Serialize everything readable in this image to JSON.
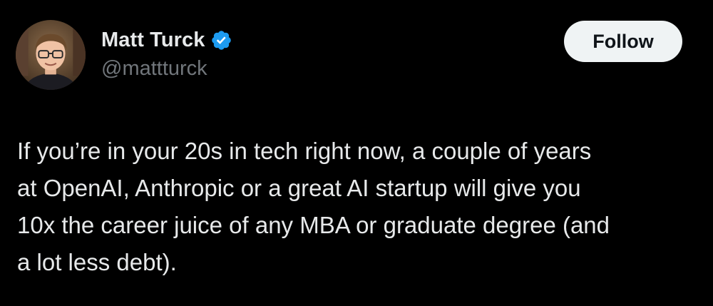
{
  "author": {
    "display_name": "Matt Turck",
    "handle": "@mattturck",
    "verified": true,
    "verified_color": "#1d9bf0"
  },
  "follow_button": {
    "label": "Follow"
  },
  "tweet": {
    "lines": [
      "If you’re in your 20s in tech right now, a couple of years",
      "at OpenAI, Anthropic or a great AI startup will give you",
      "10x the career juice of any MBA or graduate degree (and",
      "a lot less debt)."
    ]
  },
  "colors": {
    "background": "#000000",
    "text_primary": "#e7e9ea",
    "text_secondary": "#71767b",
    "button_bg": "#eff3f4"
  },
  "icons": {
    "avatar": "avatar",
    "verified": "verified-badge-icon"
  }
}
